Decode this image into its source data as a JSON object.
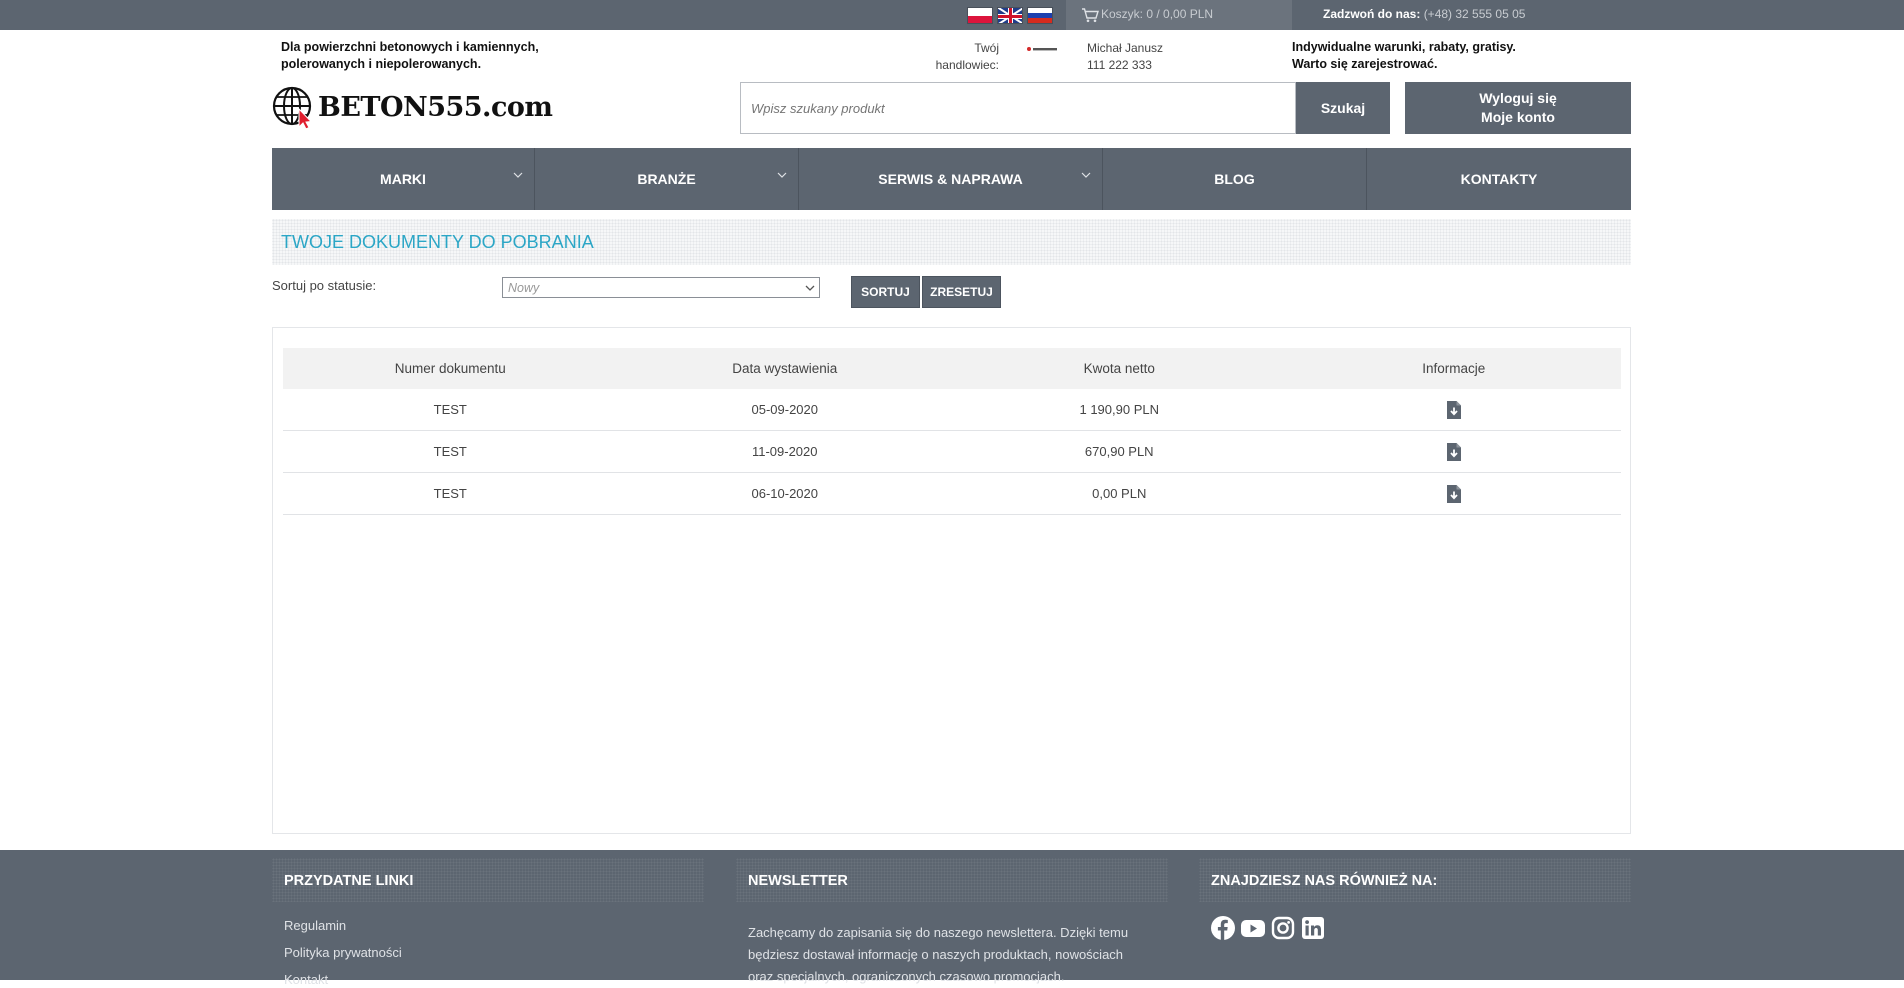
{
  "topbar": {
    "languages": [
      "PL",
      "EN",
      "RU"
    ],
    "cart_text": "Koszyk: 0 / 0,00 PLN",
    "call_label": "Zadzwoń do nas:",
    "call_number": "(+48) 32 555 05 05"
  },
  "header": {
    "tagline_line1": "Dla powierzchni betonowych i kamiennych,",
    "tagline_line2": "polerowanych i niepolerowanych.",
    "logo_text": "BETON555.com",
    "rep_label_line1": "Twój",
    "rep_label_line2": "handlowiec:",
    "rep_name": "Michał Janusz",
    "rep_phone": "111 222 333",
    "promo_line1": "Indywidualne warunki, rabaty, gratisy.",
    "promo_line2": "Warto się zarejestrować.",
    "search_placeholder": "Wpisz szukany produkt",
    "search_button": "Szukaj",
    "logout_label": "Wyloguj się",
    "account_label": "Moje konto"
  },
  "nav": {
    "items": [
      {
        "label": "MARKI",
        "has_dropdown": true
      },
      {
        "label": "BRANŻE",
        "has_dropdown": true
      },
      {
        "label": "SERWIS & NAPRAWA",
        "has_dropdown": true
      },
      {
        "label": "BLOG",
        "has_dropdown": false
      },
      {
        "label": "KONTAKTY",
        "has_dropdown": false
      }
    ]
  },
  "page": {
    "title": "TWOJE DOKUMENTY DO POBRANIA",
    "filter_label": "Sortuj po statusie:",
    "status_value": "Nowy",
    "sort_button": "SORTUJ",
    "reset_button": "ZRESETUJ"
  },
  "table": {
    "headers": [
      "Numer dokumentu",
      "Data wystawienia",
      "Kwota netto",
      "Informacje"
    ],
    "rows": [
      {
        "number": "TEST",
        "date": "05-09-2020",
        "amount": "1 190,90 PLN",
        "info_icon": "download-file-icon"
      },
      {
        "number": "TEST",
        "date": "11-09-2020",
        "amount": "670,90 PLN",
        "info_icon": "download-file-icon"
      },
      {
        "number": "TEST",
        "date": "06-10-2020",
        "amount": "0,00 PLN",
        "info_icon": "download-file-icon"
      }
    ]
  },
  "footer": {
    "useful_links_title": "PRZYDATNE LINKI",
    "links": [
      "Regulamin",
      "Polityka prywatności",
      "Kontakt"
    ],
    "newsletter_title": "NEWSLETTER",
    "newsletter_text": "Zachęcamy do zapisania się do naszego newslettera. Dzięki temu będziesz dostawał informację o naszych produktach, nowościach oraz specjalnych, ograniczonych czasowo promocjach.",
    "social_title": "ZNAJDZIESZ NAS RÓWNIEŻ NA:",
    "social_icons": [
      "facebook-icon",
      "youtube-icon",
      "instagram-icon",
      "linkedin-icon"
    ]
  },
  "colors": {
    "primary_gray": "#5c6570",
    "accent_blue": "#2ba6c6"
  }
}
